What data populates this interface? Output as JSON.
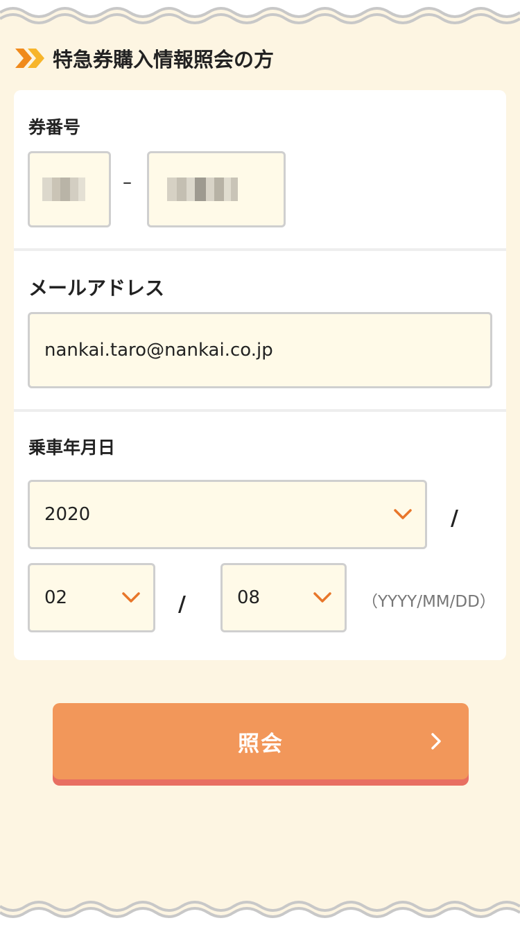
{
  "header": {
    "title": "特急券購入情報照会の方"
  },
  "form": {
    "ticket_number": {
      "label": "券番号",
      "separator": "–"
    },
    "email": {
      "label": "メールアドレス",
      "value": "nankai.taro@nankai.co.jp"
    },
    "boarding_date": {
      "label": "乗車年月日",
      "year": "2020",
      "month": "02",
      "day": "08",
      "separator": "/",
      "format_hint": "（YYYY/MM/DD）"
    }
  },
  "submit": {
    "label": "照会"
  },
  "colors": {
    "background": "#fdf5e2",
    "field_background": "#fffae8",
    "accent": "#e8762a",
    "button": "#f2975a",
    "button_shadow": "#e86f62"
  },
  "icons": [
    "double-chevron-icon",
    "chevron-down-icon",
    "chevron-right-icon"
  ]
}
